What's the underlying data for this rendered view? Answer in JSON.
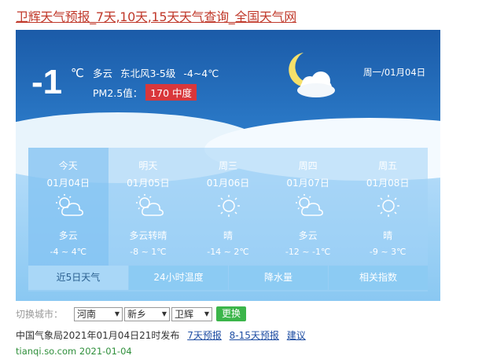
{
  "page_title": "卫辉天气预报_7天,10天,15天天气查询_全国天气网",
  "current": {
    "temperature": "-1",
    "unit": "℃",
    "condition_line": "多云 东北风3-5级 -4~4℃",
    "pm_label": "PM2.5值：",
    "pm_value": "170 中度",
    "date": "周一/01月04日"
  },
  "forecast": [
    {
      "day": "今天",
      "date": "01月04日",
      "icon": "partly-cloudy-icon",
      "cond": "多云",
      "range": "-4 ~ 4℃"
    },
    {
      "day": "明天",
      "date": "01月05日",
      "icon": "partly-cloudy-icon",
      "cond": "多云转晴",
      "range": "-8 ~ 1℃"
    },
    {
      "day": "周三",
      "date": "01月06日",
      "icon": "sun-icon",
      "cond": "晴",
      "range": "-14 ~ 2℃"
    },
    {
      "day": "周四",
      "date": "01月07日",
      "icon": "partly-cloudy-icon",
      "cond": "多云",
      "range": "-12 ~ -1℃"
    },
    {
      "day": "周五",
      "date": "01月08日",
      "icon": "sun-icon",
      "cond": "晴",
      "range": "-9 ~ 3℃"
    }
  ],
  "tabs": [
    "近5日天气",
    "24小时温度",
    "降水量",
    "相关指数"
  ],
  "city_switch": {
    "label": "切换城市：",
    "province": "河南",
    "city": "新乡",
    "county": "卫辉",
    "button": "更换"
  },
  "publish": {
    "text": "中国气象局2021年01月04日21时发布",
    "link_7day": "7天预报",
    "link_15day": "8-15天预报",
    "link_suggest": "建议"
  },
  "source": "tianqi.so.com 2021-01-04",
  "colors": {
    "title": "#c0392b",
    "pm_badge": "#d9373b",
    "switch_button": "#3bb54a",
    "link": "#1f4ea3",
    "source": "#2f8f3b"
  }
}
